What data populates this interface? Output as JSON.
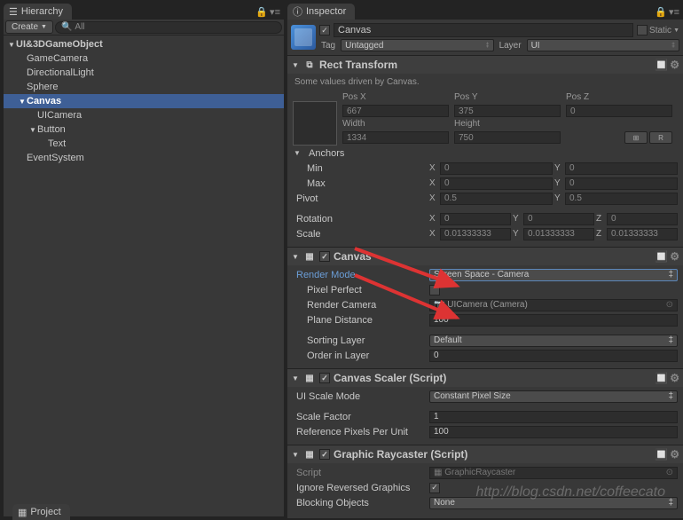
{
  "hierarchy": {
    "tab": "Hierarchy",
    "create": "Create",
    "search_placeholder": "All",
    "items": [
      {
        "label": "UI&3DGameObject",
        "depth": 0,
        "expanded": true,
        "bold": true
      },
      {
        "label": "GameCamera",
        "depth": 1
      },
      {
        "label": "DirectionalLight",
        "depth": 1
      },
      {
        "label": "Sphere",
        "depth": 1
      },
      {
        "label": "Canvas",
        "depth": 1,
        "expanded": true,
        "bold": true,
        "selected": true
      },
      {
        "label": "UICamera",
        "depth": 2
      },
      {
        "label": "Button",
        "depth": 2,
        "expanded": true
      },
      {
        "label": "Text",
        "depth": 3
      },
      {
        "label": "EventSystem",
        "depth": 1
      }
    ]
  },
  "project_tab": "Project",
  "inspector": {
    "tab": "Inspector",
    "obj_name": "Canvas",
    "static_label": "Static",
    "tag_label": "Tag",
    "tag_value": "Untagged",
    "layer_label": "Layer",
    "layer_value": "UI"
  },
  "rect": {
    "title": "Rect Transform",
    "info": "Some values driven by Canvas.",
    "posx_label": "Pos X",
    "posx": "667",
    "posy_label": "Pos Y",
    "posy": "375",
    "posz_label": "Pos Z",
    "posz": "0",
    "width_label": "Width",
    "width": "1334",
    "height_label": "Height",
    "height": "750",
    "r_button": "R",
    "anchors_label": "Anchors",
    "min_label": "Min",
    "min_x": "0",
    "min_y": "0",
    "max_label": "Max",
    "max_x": "0",
    "max_y": "0",
    "pivot_label": "Pivot",
    "pivot_x": "0.5",
    "pivot_y": "0.5",
    "rotation_label": "Rotation",
    "rot_x": "0",
    "rot_y": "0",
    "rot_z": "0",
    "scale_label": "Scale",
    "scale_x": "0.01333333",
    "scale_y": "0.01333333",
    "scale_z": "0.01333333",
    "xl": "X",
    "yl": "Y",
    "zl": "Z"
  },
  "canvas": {
    "title": "Canvas",
    "render_mode_label": "Render Mode",
    "render_mode_value": "Screen Space - Camera",
    "pixel_perfect_label": "Pixel Perfect",
    "render_camera_label": "Render Camera",
    "render_camera_value": "UICamera (Camera)",
    "plane_distance_label": "Plane Distance",
    "plane_distance_value": "100",
    "sorting_layer_label": "Sorting Layer",
    "sorting_layer_value": "Default",
    "order_label": "Order in Layer",
    "order_value": "0"
  },
  "scaler": {
    "title": "Canvas Scaler (Script)",
    "mode_label": "UI Scale Mode",
    "mode_value": "Constant Pixel Size",
    "scale_factor_label": "Scale Factor",
    "scale_factor_value": "1",
    "ref_px_label": "Reference Pixels Per Unit",
    "ref_px_value": "100"
  },
  "raycaster": {
    "title": "Graphic Raycaster (Script)",
    "script_label": "Script",
    "script_value": "GraphicRaycaster",
    "ignore_label": "Ignore Reversed Graphics",
    "blocking_label": "Blocking Objects",
    "blocking_value": "None"
  },
  "watermark": "http://blog.csdn.net/coffeecato"
}
